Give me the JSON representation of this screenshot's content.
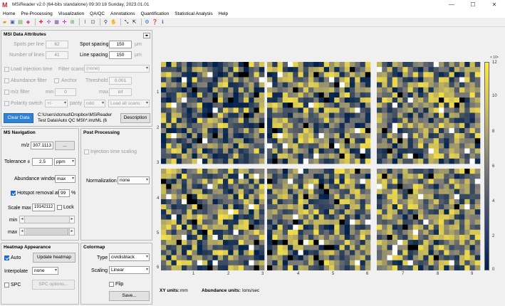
{
  "window": {
    "title": "MSiReader  v2.0  (64-bits standalone)  09:30:18 Sunday, 2023.01.01",
    "logo": "M",
    "controls": [
      "—",
      "☐",
      "✕"
    ]
  },
  "menu": [
    "Home",
    "Pre-Processing",
    "Visualization",
    "QA/QC",
    "Annotations",
    "Quantification",
    "Statistical Analysis",
    "Help"
  ],
  "toolbar_icons": [
    "open-folder-icon",
    "save-icon",
    "image-export-icon",
    "palette-icon",
    "rgb-icon",
    "spectrum-icon",
    "grid-icon",
    "list-icon",
    "peaks-icon",
    "line-graph-icon",
    "zoom-in-icon",
    "zoom-out-icon",
    "hand-icon",
    "arrows-icon",
    "axes-icon",
    "settings-icon",
    "help-icon",
    "info-icon"
  ],
  "attrs": {
    "heading": "MSI Data Attributes",
    "spots_per_line_label": "Spots per line",
    "spots_per_line_value": "62",
    "spot_spacing_label": "Spot spacing",
    "spot_spacing_value": "150",
    "spot_spacing_unit": "μm",
    "lines_label": "Number of lines",
    "lines_value": "41",
    "line_spacing_label": "Line spacing",
    "line_spacing_value": "150",
    "line_spacing_unit": "μm",
    "load_injection_label": "Load injection time",
    "filter_scans_label": "Filter scans",
    "filter_scans_value": "(none)",
    "abundance_filter_label": "Abundance filter",
    "anchor_label": "Anchor",
    "threshold_label": "Threshold",
    "threshold_value": "0.001",
    "mz_filter_label": "m/z filter",
    "min_label": "min",
    "min_value": "0",
    "max_label": "max",
    "max_value": "inf",
    "polarity_label": "Polarity switch",
    "polarity_value": "+/-",
    "parity_label": "parity",
    "parity_value": "odd",
    "load_all_value": "Load all scans",
    "clear_data_label": "Clear Data",
    "path_line1": "C:\\Users\\dcmud\\Dropbox\\MSiReader",
    "path_line2": "Test Data\\Auto QC MSI\\*.imzML (6",
    "description_label": "Description"
  },
  "nav": {
    "heading": "MS Navigation",
    "mz_label": "m/z",
    "mz_value": "307.1113",
    "mz_btn": "...",
    "tolerance_label": "Tolerance ±",
    "tolerance_value": "2.5",
    "tolerance_unit": "ppm",
    "abundance_window_label": "Abundance window",
    "abundance_window_value": "max",
    "hotspot_label": "Hotspot removal at",
    "hotspot_value": "99",
    "hotspot_unit": "%",
    "scale_max_label": "Scale max",
    "scale_max_value": "19142112",
    "lock_label": "Lock",
    "min_label": "min",
    "max_label": "max"
  },
  "post": {
    "heading": "Post Processing",
    "injection_scaling_label": "Injection time scaling",
    "normalization_label": "Normalization",
    "normalization_value": "none"
  },
  "heatmap": {
    "heading": "Heatmap Appearance",
    "auto_label": "Auto",
    "update_label": "Update heatmap",
    "interpolate_label": "Interpolate",
    "interpolate_value": "none",
    "spc_label": "SPC",
    "spc_options_label": "SPC options..."
  },
  "colormap": {
    "heading": "Colormap",
    "type_label": "Type",
    "type_value": "cividisblack",
    "scaling_label": "Scaling",
    "scaling_value": "Linear",
    "flip_label": "Flip",
    "save_label": "Save..."
  },
  "plot": {
    "y_ticks": [
      "1",
      "2",
      "3",
      "4",
      "5",
      "6"
    ],
    "x_ticks": [
      "1",
      "2",
      "3",
      "4",
      "5",
      "6",
      "7",
      "8",
      "9"
    ],
    "colorbar_exponent": "× 10⁶",
    "colorbar_ticks": [
      "12",
      "10",
      "8",
      "6",
      "4",
      "2",
      "0"
    ],
    "xy_units_label": "XY units:",
    "xy_units_value": "mm",
    "abundance_units_label": "Abundance units:",
    "abundance_units_value": "Ions/sec",
    "colors": {
      "low": "#00204c",
      "mid": "#7c7b78",
      "high": "#ffe945"
    }
  }
}
